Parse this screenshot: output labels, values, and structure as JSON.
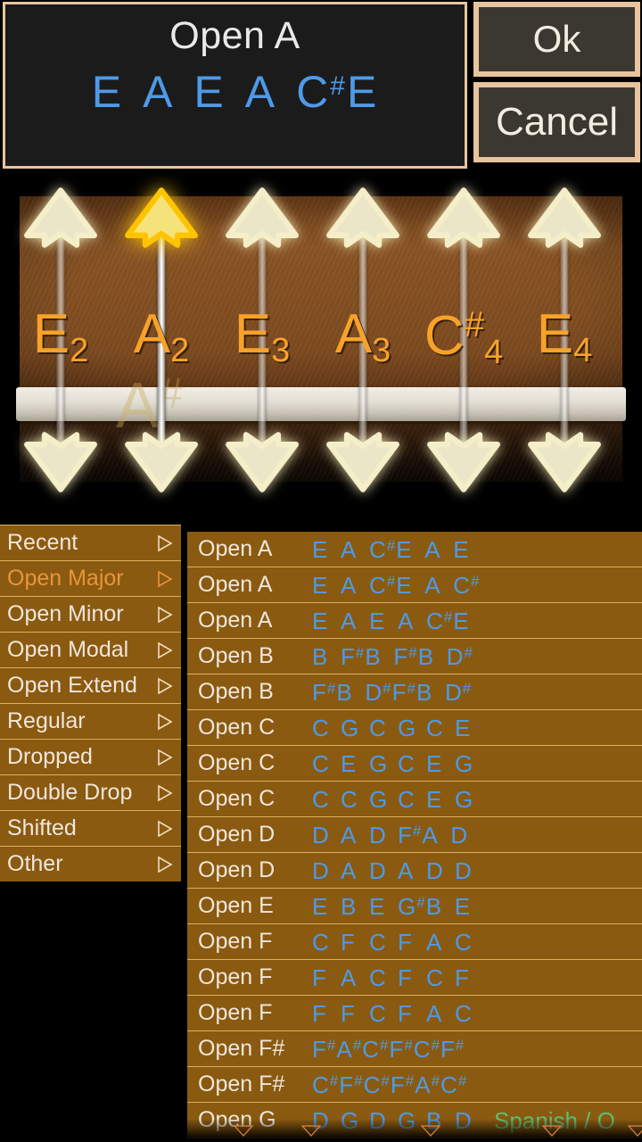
{
  "header": {
    "tuning_name": "Open A",
    "notes": [
      {
        "letter": "E",
        "sharp": false
      },
      {
        "letter": "A",
        "sharp": false
      },
      {
        "letter": "E",
        "sharp": false
      },
      {
        "letter": "A",
        "sharp": false
      },
      {
        "letter": "C",
        "sharp": true
      },
      {
        "letter": "E",
        "sharp": false
      }
    ],
    "ok_label": "Ok",
    "cancel_label": "Cancel"
  },
  "colors": {
    "accent_orange": "#f8a229",
    "note_blue": "#4d9ae8",
    "list_brown": "#8a5a10",
    "list_divider": "#d9b25a",
    "selected_text": "#e8953a",
    "alt_green": "#5fbd74",
    "panel_border": "#e8c49e",
    "panel_bg": "#1b1b1b",
    "highlight_peg": "#ffc400"
  },
  "tuner": {
    "ghost_note": {
      "letter": "A",
      "sharp": true
    },
    "strings": [
      {
        "note": "E",
        "sharp": false,
        "octave": "2",
        "active": false
      },
      {
        "note": "A",
        "sharp": false,
        "octave": "2",
        "active": true
      },
      {
        "note": "E",
        "sharp": false,
        "octave": "3",
        "active": false
      },
      {
        "note": "A",
        "sharp": false,
        "octave": "3",
        "active": false
      },
      {
        "note": "C",
        "sharp": true,
        "octave": "4",
        "active": false
      },
      {
        "note": "E",
        "sharp": false,
        "octave": "4",
        "active": false
      }
    ]
  },
  "sidebar": {
    "items": [
      {
        "label": "Recent",
        "selected": false
      },
      {
        "label": "Open Major",
        "selected": true
      },
      {
        "label": "Open Minor",
        "selected": false
      },
      {
        "label": "Open Modal",
        "selected": false
      },
      {
        "label": "Open Extend",
        "selected": false
      },
      {
        "label": "Regular",
        "selected": false
      },
      {
        "label": "Dropped",
        "selected": false
      },
      {
        "label": "Double Drop",
        "selected": false
      },
      {
        "label": "Shifted",
        "selected": false
      },
      {
        "label": "Other",
        "selected": false
      }
    ]
  },
  "tuning_list": {
    "rows": [
      {
        "name": "Open A",
        "notes": "E A C#E A E",
        "alt": ""
      },
      {
        "name": "Open A",
        "notes": "E A C#E A C#",
        "alt": ""
      },
      {
        "name": "Open A",
        "notes": "E A E A C#E",
        "alt": ""
      },
      {
        "name": "Open B",
        "notes": "B F#B F#B D#",
        "alt": ""
      },
      {
        "name": "Open B",
        "notes": "F#B D#F#B D#",
        "alt": ""
      },
      {
        "name": "Open C",
        "notes": "C G C G C E",
        "alt": ""
      },
      {
        "name": "Open C",
        "notes": "C E G C E G",
        "alt": ""
      },
      {
        "name": "Open C",
        "notes": "C C G C E G",
        "alt": ""
      },
      {
        "name": "Open D",
        "notes": "D A D F#A D",
        "alt": ""
      },
      {
        "name": "Open D",
        "notes": "D A D A D D",
        "alt": ""
      },
      {
        "name": "Open E",
        "notes": "E B E G#B E",
        "alt": ""
      },
      {
        "name": "Open F",
        "notes": "C F C F A C",
        "alt": ""
      },
      {
        "name": "Open F",
        "notes": "F A C F C F",
        "alt": ""
      },
      {
        "name": "Open F",
        "notes": "F F C F A C",
        "alt": ""
      },
      {
        "name": "Open F#",
        "notes": "F#A#C#F#C#F#",
        "alt": ""
      },
      {
        "name": "Open F#",
        "notes": "C#F#C#F#A#C#",
        "alt": ""
      },
      {
        "name": "Open G",
        "notes": "D G D G B D",
        "alt": "Spanish / O"
      }
    ]
  }
}
